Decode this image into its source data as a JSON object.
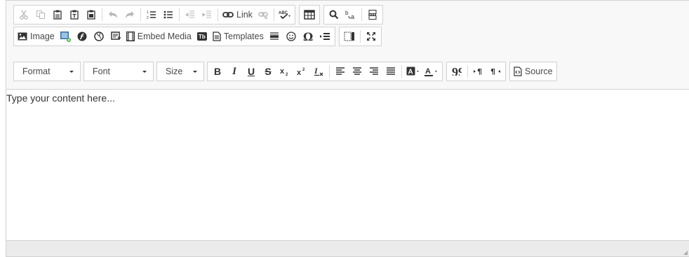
{
  "toolbar": {
    "row1": {
      "link_label": "Link",
      "icons": [
        "cut-icon",
        "copy-icon",
        "paste-icon",
        "paste-text-icon",
        "paste-word-icon",
        "undo-icon",
        "redo-icon",
        "numbered-list-icon",
        "bulleted-list-icon",
        "outdent-icon",
        "indent-icon",
        "link-icon",
        "unlink-icon",
        "spellcheck-icon",
        "table-icon",
        "find-icon",
        "replace-icon",
        "page-break-icon"
      ]
    },
    "row2": {
      "image_label": "Image",
      "embed_label": "Embed Media",
      "templates_label": "Templates"
    },
    "row3": {
      "format_label": "Format",
      "font_label": "Font",
      "size_label": "Size",
      "bold": "B",
      "italic": "I",
      "underline": "U",
      "strike": "S",
      "source_label": "Source"
    }
  },
  "content": {
    "placeholder": "Type your content here..."
  },
  "colors": {
    "toolbar_bg": "#f8f8f8",
    "border": "#d1d1d1",
    "bottom_bar": "#ebebeb"
  }
}
